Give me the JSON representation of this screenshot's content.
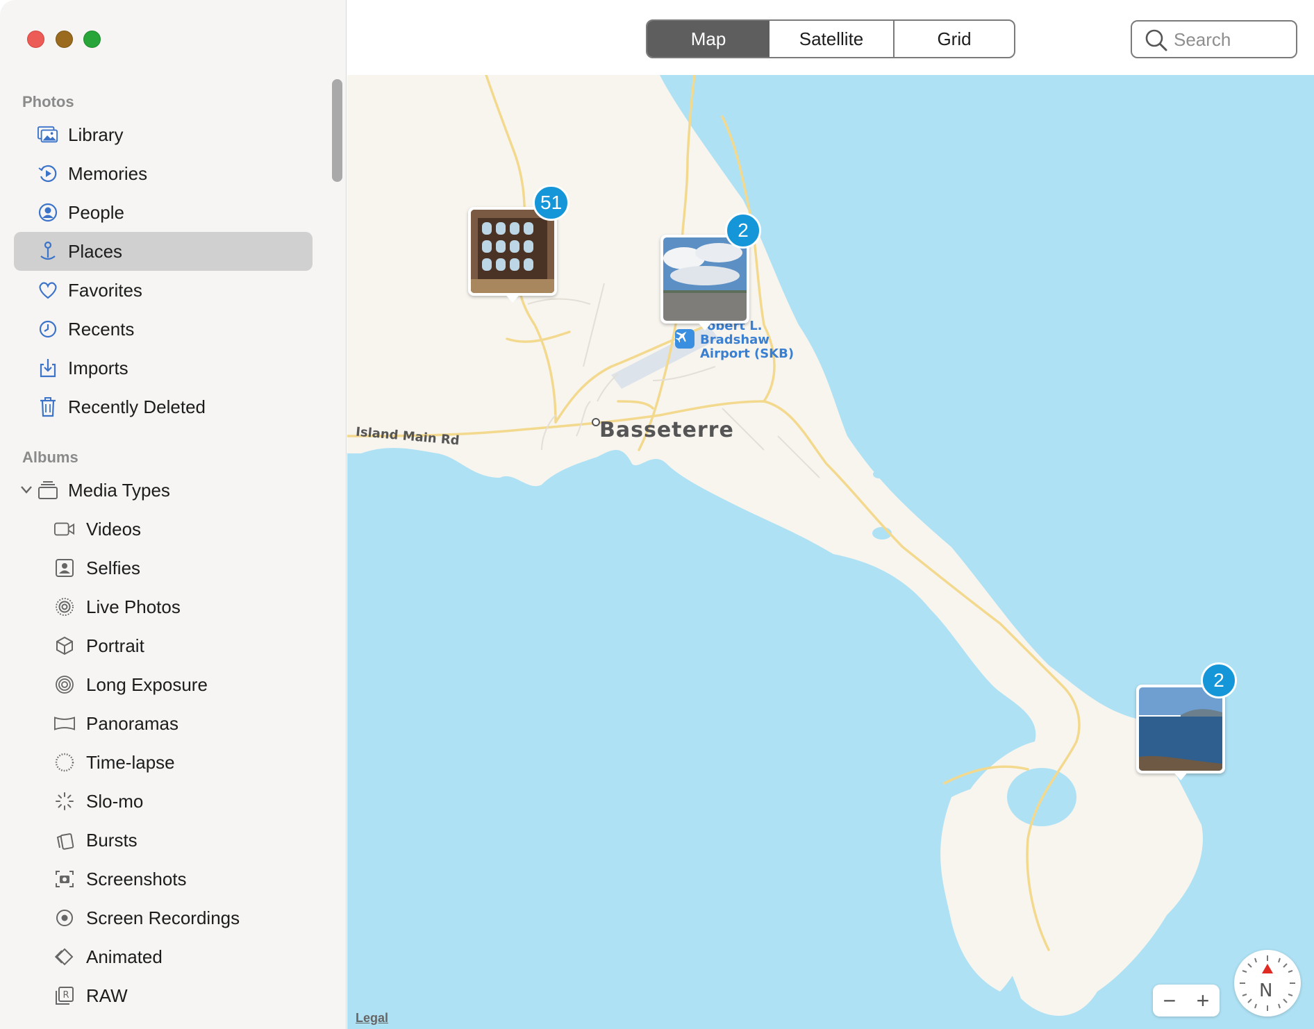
{
  "sidebar": {
    "photos_header": "Photos",
    "library": "Library",
    "memories": "Memories",
    "people": "People",
    "places": "Places",
    "favorites": "Favorites",
    "recents": "Recents",
    "imports": "Imports",
    "recently_deleted": "Recently Deleted",
    "albums_header": "Albums",
    "media_types": "Media Types",
    "videos": "Videos",
    "selfies": "Selfies",
    "live_photos": "Live Photos",
    "portrait": "Portrait",
    "long_exposure": "Long Exposure",
    "panoramas": "Panoramas",
    "time_lapse": "Time-lapse",
    "slo_mo": "Slo-mo",
    "bursts": "Bursts",
    "screenshots": "Screenshots",
    "screen_recordings": "Screen Recordings",
    "animated": "Animated",
    "raw": "RAW"
  },
  "toolbar": {
    "map": "Map",
    "satellite": "Satellite",
    "grid": "Grid",
    "search_placeholder": "Search"
  },
  "map": {
    "city": "Basseterre",
    "road": "Island Main Rd",
    "airport_line1": "obert L.",
    "airport_line2": "Bradshaw",
    "airport_line3": "Airport (SKB)",
    "pin1_count": "51",
    "pin2_count": "2",
    "pin3_count": "2",
    "legal": "Legal",
    "zoom_out": "−",
    "zoom_in": "+",
    "compass_n": "N"
  },
  "colors": {
    "accent": "#3b73c9",
    "badge": "#1596d8",
    "water": "#aee1f4",
    "land": "#f8f5ef"
  }
}
